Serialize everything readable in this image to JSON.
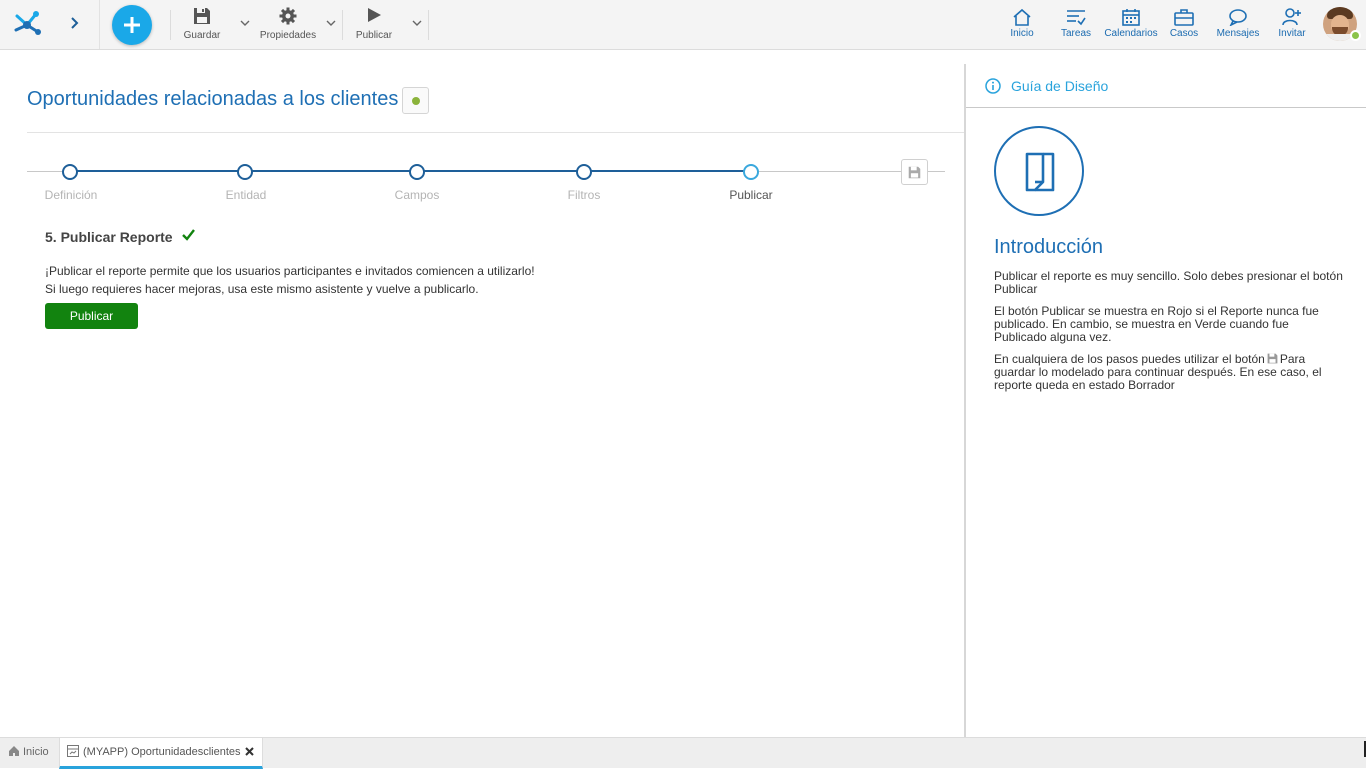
{
  "toolbar": {
    "save_label": "Guardar",
    "properties_label": "Propiedades",
    "publish_label": "Publicar"
  },
  "nav": {
    "home_label": "Inicio",
    "tasks_label": "Tareas",
    "calendars_label": "Calendarios",
    "cases_label": "Casos",
    "messages_label": "Mensajes",
    "invite_label": "Invitar"
  },
  "page": {
    "title": "Oportunidades relacionadas a los clientes"
  },
  "wizard": {
    "steps": [
      "Definición",
      "Entidad",
      "Campos",
      "Filtros",
      "Publicar"
    ],
    "active_step": "Publicar"
  },
  "content": {
    "section_title": "5. Publicar Reporte",
    "line1": "¡Publicar el reporte permite que los usuarios participantes e invitados comiencen a utilizarlo!",
    "line2": "Si luego requieres hacer mejoras, usa este mismo asistente y vuelve a publicarlo.",
    "publish_button": "Publicar",
    "publish_button_color": "#12830f"
  },
  "guide": {
    "header": "Guía de Diseño",
    "intro_title": "Introducción",
    "p1": "Publicar el reporte es muy sencillo. Solo debes presionar el botón Publicar",
    "p2": "El botón Publicar se muestra en Rojo si el Reporte nunca fue publicado. En cambio, se muestra en Verde cuando fue Publicado alguna vez.",
    "p3_before": "En cualquiera de los pasos puedes utilizar el botón",
    "p3_after": "Para guardar lo modelado para continuar después. En ese caso, el reporte queda en estado Borrador"
  },
  "tabs": {
    "home_label": "Inicio",
    "app_label": "(MYAPP) Oportunidadesclientes"
  },
  "colors": {
    "accent": "#1aa8e8",
    "title_blue": "#1e6fb4",
    "status_green": "#8bc34a"
  }
}
